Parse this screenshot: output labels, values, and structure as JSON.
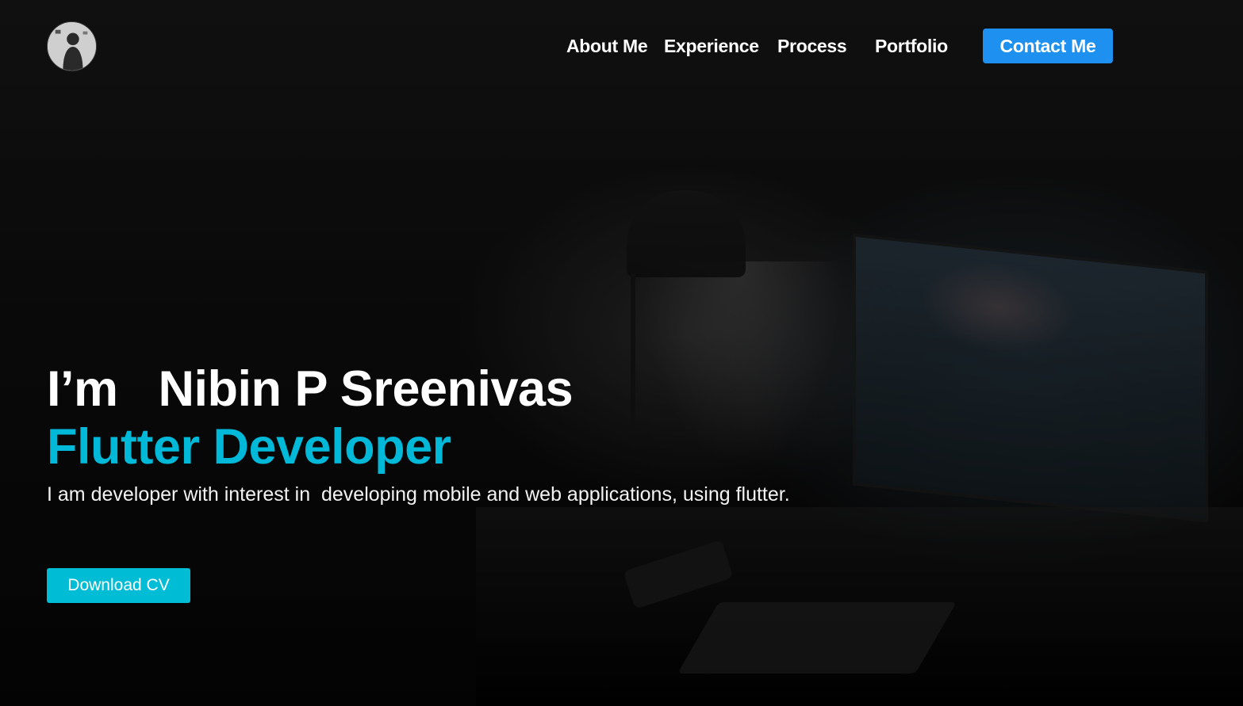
{
  "nav": {
    "links": [
      {
        "label": "About Me"
      },
      {
        "label": "Experience"
      },
      {
        "label": "Process"
      },
      {
        "label": "Portfolio"
      }
    ],
    "contact_label": "Contact Me"
  },
  "hero": {
    "intro_prefix": "I’m",
    "name": "Nibin P Sreenivas",
    "role": "Flutter Developer",
    "description": "I am developer with interest in  developing mobile and web applications, using flutter.",
    "download_label": "Download CV"
  },
  "colors": {
    "accent": "#00bcd4",
    "contact_button": "#1e90f0",
    "background": "#0b0b0b",
    "text": "#ffffff"
  },
  "icons": {
    "avatar": "profile-photo"
  }
}
